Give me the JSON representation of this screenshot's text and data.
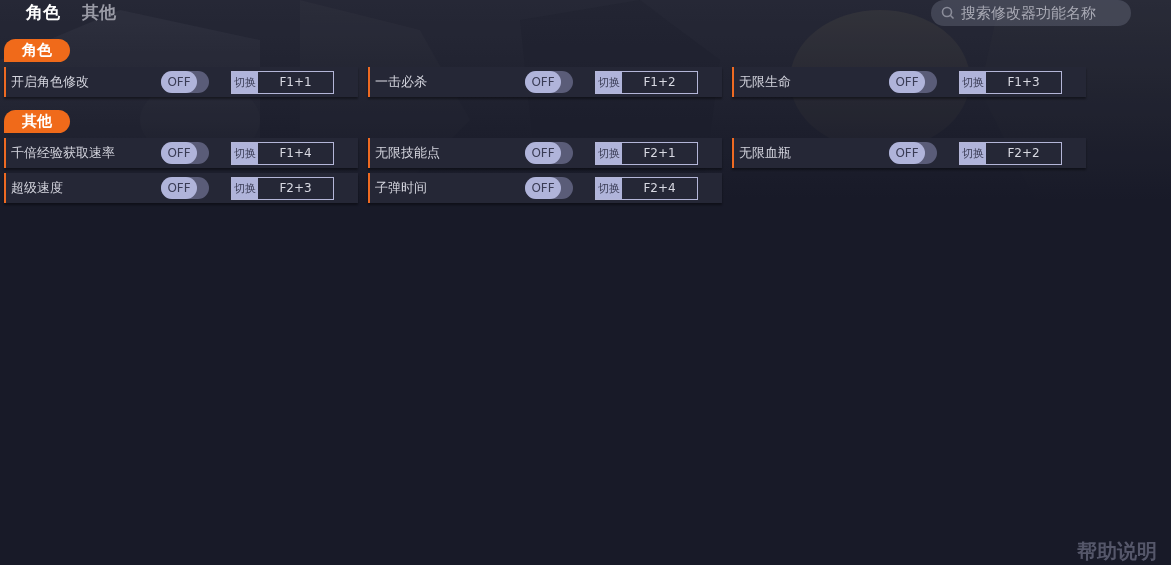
{
  "tabs": [
    {
      "label": "角色",
      "selected": true
    },
    {
      "label": "其他",
      "selected": false
    }
  ],
  "search": {
    "placeholder": "搜索修改器功能名称"
  },
  "sections": [
    {
      "title": "角色",
      "items": [
        {
          "name": "开启角色修改",
          "on": false,
          "state_text": "OFF",
          "hotkey_label": "切换",
          "hotkey": "F1+1"
        },
        {
          "name": "一击必杀",
          "on": false,
          "state_text": "OFF",
          "hotkey_label": "切换",
          "hotkey": "F1+2"
        },
        {
          "name": "无限生命",
          "on": false,
          "state_text": "OFF",
          "hotkey_label": "切换",
          "hotkey": "F1+3"
        }
      ]
    },
    {
      "title": "其他",
      "items": [
        {
          "name": "千倍经验获取速率",
          "on": false,
          "state_text": "OFF",
          "hotkey_label": "切换",
          "hotkey": "F1+4"
        },
        {
          "name": "无限技能点",
          "on": false,
          "state_text": "OFF",
          "hotkey_label": "切换",
          "hotkey": "F2+1"
        },
        {
          "name": "无限血瓶",
          "on": false,
          "state_text": "OFF",
          "hotkey_label": "切换",
          "hotkey": "F2+2"
        },
        {
          "name": "超级速度",
          "on": false,
          "state_text": "OFF",
          "hotkey_label": "切换",
          "hotkey": "F2+3"
        },
        {
          "name": "子弹时间",
          "on": false,
          "state_text": "OFF",
          "hotkey_label": "切换",
          "hotkey": "F2+4"
        }
      ]
    }
  ],
  "help": "帮助说明"
}
